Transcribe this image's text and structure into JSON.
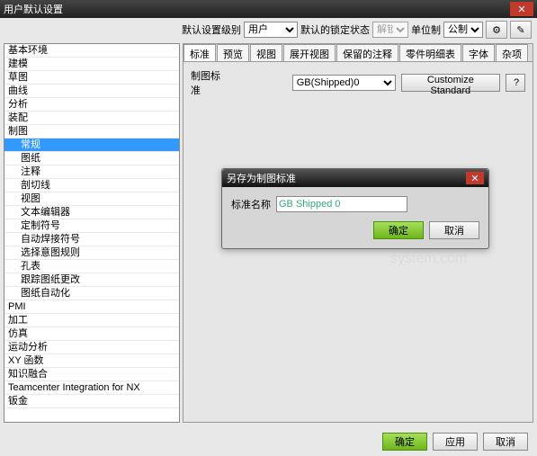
{
  "window": {
    "title": "用户默认设置"
  },
  "toolbar": {
    "level_label": "默认设置级别",
    "level_value": "用户",
    "lock_label": "默认的锁定状态",
    "lock_value": "解锁",
    "unit_label": "单位制",
    "unit_value": "公制"
  },
  "sidebar": {
    "items": [
      {
        "label": "基本环境",
        "child": false
      },
      {
        "label": "建模",
        "child": false
      },
      {
        "label": "草图",
        "child": false
      },
      {
        "label": "曲线",
        "child": false
      },
      {
        "label": "分析",
        "child": false
      },
      {
        "label": "装配",
        "child": false
      },
      {
        "label": "制图",
        "child": false
      },
      {
        "label": "常规",
        "child": true,
        "selected": true
      },
      {
        "label": "图纸",
        "child": true
      },
      {
        "label": "注释",
        "child": true
      },
      {
        "label": "剖切线",
        "child": true
      },
      {
        "label": "视图",
        "child": true
      },
      {
        "label": "文本编辑器",
        "child": true
      },
      {
        "label": "定制符号",
        "child": true
      },
      {
        "label": "自动焊接符号",
        "child": true
      },
      {
        "label": "选择意图规则",
        "child": true
      },
      {
        "label": "孔表",
        "child": true
      },
      {
        "label": "跟踪图纸更改",
        "child": true
      },
      {
        "label": "图纸自动化",
        "child": true
      },
      {
        "label": "PMI",
        "child": false
      },
      {
        "label": "加工",
        "child": false
      },
      {
        "label": "仿真",
        "child": false
      },
      {
        "label": "运动分析",
        "child": false
      },
      {
        "label": "XY 函数",
        "child": false
      },
      {
        "label": "知识融合",
        "child": false
      },
      {
        "label": "Teamcenter Integration for NX",
        "child": false
      },
      {
        "label": "钣金",
        "child": false
      }
    ]
  },
  "tabs": [
    "标准",
    "预览",
    "视图",
    "展开视图",
    "保留的注释",
    "零件明细表",
    "字体",
    "杂项"
  ],
  "param": {
    "label": "制图标准",
    "value": "GB(Shipped)0",
    "customize": "Customize Standard",
    "q": "?"
  },
  "dialog": {
    "title": "另存为制图标准",
    "name_label": "标准名称",
    "name_value": "GB Shipped 0",
    "ok": "确定",
    "cancel": "取消"
  },
  "footer": {
    "ok": "确定",
    "apply": "应用",
    "cancel": "取消"
  },
  "watermark": "system.com"
}
